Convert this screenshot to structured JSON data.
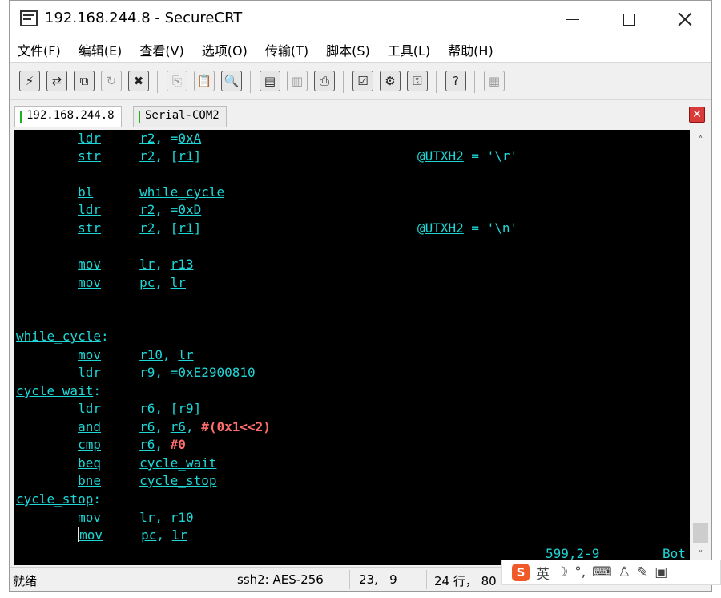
{
  "window": {
    "title": "192.168.244.8 - SecureCRT"
  },
  "menu": [
    "文件(F)",
    "编辑(E)",
    "查看(V)",
    "选项(O)",
    "传输(T)",
    "脚本(S)",
    "工具(L)",
    "帮助(H)"
  ],
  "toolbar": {
    "items": [
      {
        "name": "quick-connect-icon",
        "glyph": "⚡",
        "dim": false
      },
      {
        "name": "connect-icon",
        "glyph": "⇄",
        "dim": false
      },
      {
        "name": "connect-in-tab-icon",
        "glyph": "⧉",
        "dim": false
      },
      {
        "name": "reconnect-icon",
        "glyph": "↻",
        "dim": true
      },
      {
        "name": "disconnect-icon",
        "glyph": "✖",
        "dim": false
      },
      {
        "name": "copy-icon",
        "glyph": "⎘",
        "dim": true
      },
      {
        "name": "paste-icon",
        "glyph": "📋",
        "dim": true
      },
      {
        "name": "find-icon",
        "glyph": "🔍",
        "dim": false
      },
      {
        "name": "print-setup-icon",
        "glyph": "▤",
        "dim": false
      },
      {
        "name": "print-selection-icon",
        "glyph": "▥",
        "dim": true
      },
      {
        "name": "print-icon",
        "glyph": "⎙",
        "dim": false
      },
      {
        "name": "session-options-icon",
        "glyph": "☑",
        "dim": false
      },
      {
        "name": "global-options-icon",
        "glyph": "⚙",
        "dim": false
      },
      {
        "name": "keymap-icon",
        "glyph": "⚿",
        "dim": false
      },
      {
        "name": "help-icon",
        "glyph": "?",
        "dim": false
      },
      {
        "name": "sftp-icon",
        "glyph": "▦",
        "dim": true
      }
    ]
  },
  "tabs": [
    {
      "label": "192.168.244.8",
      "active": true
    },
    {
      "label": "Serial-COM2",
      "active": false
    }
  ],
  "tab_close_glyph": "✕",
  "terminal": {
    "lines": [
      "        ldr     r2, =0xA",
      "        str     r2, [r1]                            @UTXH2 = '\\r'",
      "",
      "        bl      while_cycle",
      "        ldr     r2, =0xD",
      "        str     r2, [r1]                            @UTXH2 = '\\n'",
      "",
      "        mov     lr, r13",
      "        mov     pc, lr",
      "",
      "",
      "while_cycle:",
      "        mov     r10, lr",
      "        ldr     r9, =0xE2900810",
      "cycle_wait:",
      "        ldr     r6, [r9]",
      "        and     r6, r6, #(0x1<<2)",
      "        cmp     r6, #0",
      "        beq     cycle_wait",
      "        bne     cycle_stop",
      "cycle_stop:",
      "        mov     lr, r10",
      "        mov     pc, lr"
    ],
    "position": "599,2-9",
    "scroll": "Bot"
  },
  "status": {
    "ready": "就绪",
    "protocol": "ssh2: AES-256",
    "cursor_pos": "23,   9",
    "size": "24 行， 80"
  },
  "ime": {
    "logo": "S",
    "items": [
      {
        "name": "ime-language-icon",
        "glyph": "英"
      },
      {
        "name": "ime-moon-icon",
        "glyph": "☽"
      },
      {
        "name": "ime-punctuation-icon",
        "glyph": "°,"
      },
      {
        "name": "ime-keyboard-icon",
        "glyph": "⌨"
      },
      {
        "name": "ime-user-icon",
        "glyph": "♙"
      },
      {
        "name": "ime-tools-icon",
        "glyph": "✎"
      },
      {
        "name": "ime-skin-icon",
        "glyph": "▣"
      }
    ]
  }
}
